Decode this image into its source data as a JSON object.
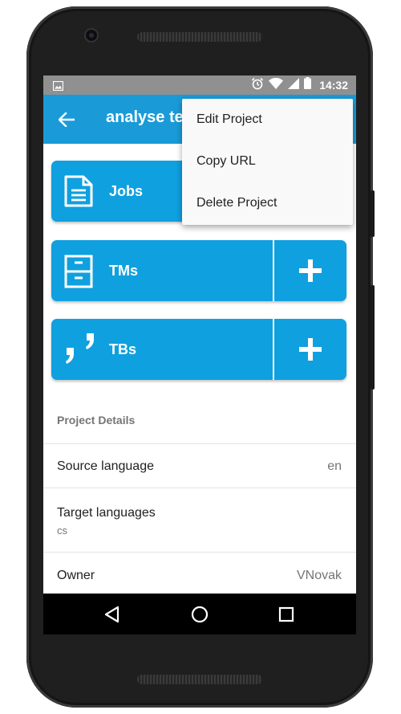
{
  "status_bar": {
    "time": "14:32",
    "icons": [
      "image-notification-icon",
      "alarm-icon",
      "wifi-icon",
      "cell-signal-icon",
      "battery-icon"
    ]
  },
  "app_bar": {
    "title": "analyse te",
    "back_icon": "arrow-left-icon"
  },
  "menu": {
    "items": [
      "Edit Project",
      "Copy URL",
      "Delete Project"
    ]
  },
  "tiles": [
    {
      "label": "Jobs",
      "icon": "document-icon"
    },
    {
      "label": "TMs",
      "icon": "cabinet-icon",
      "action_icon": "plus-icon"
    },
    {
      "label": "TBs",
      "icon": "quote-icon",
      "action_icon": "plus-icon"
    }
  ],
  "details": {
    "section_title": "Project Details",
    "source_language_label": "Source language",
    "source_language_value": "en",
    "target_languages_label": "Target languages",
    "target_languages_value": "cs",
    "owner_label": "Owner",
    "owner_value": "VNovak"
  },
  "nav_bar": {
    "icons": [
      "back-triangle-icon",
      "home-circle-icon",
      "recents-square-icon"
    ]
  },
  "colors": {
    "accent": "#1a9bd7",
    "tile": "#0fa0df",
    "status_bar": "#909090",
    "menu_bg": "#f9f9f9"
  }
}
